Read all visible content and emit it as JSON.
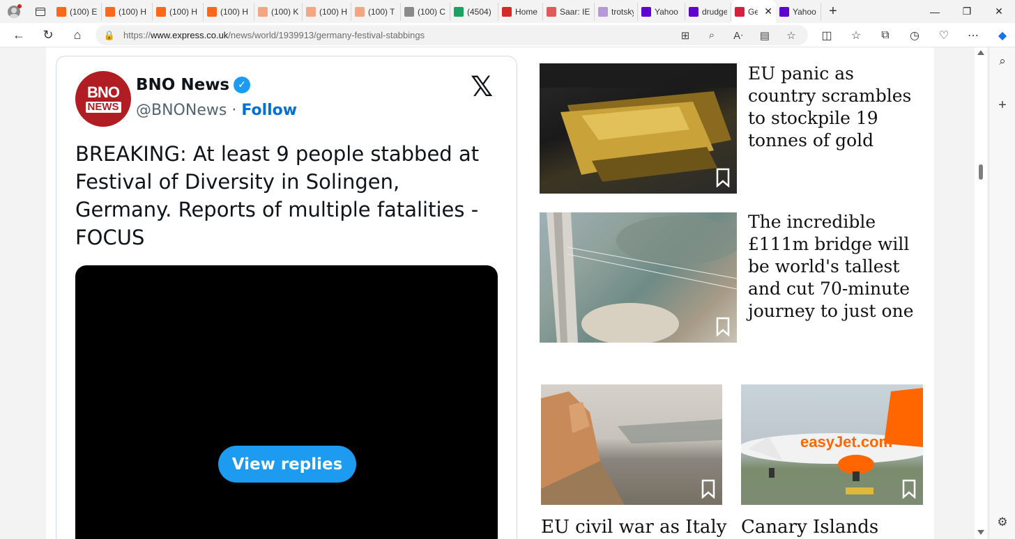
{
  "tabs": [
    {
      "label": "(100) E",
      "favicon": "substack-icon",
      "color": "#ff6719"
    },
    {
      "label": "(100) H",
      "favicon": "substack-icon",
      "color": "#ff6719"
    },
    {
      "label": "(100) H",
      "favicon": "substack-icon",
      "color": "#ff6719"
    },
    {
      "label": "(100) H",
      "favicon": "substack-icon",
      "color": "#ff6719"
    },
    {
      "label": "(100) K",
      "favicon": "substack-icon",
      "color": "#f4a582"
    },
    {
      "label": "(100) H",
      "favicon": "substack-icon",
      "color": "#f4a582"
    },
    {
      "label": "(100) T",
      "favicon": "substack-icon",
      "color": "#f4a582"
    },
    {
      "label": "(100) C",
      "favicon": "grid-icon",
      "color": "#8a8a8a"
    },
    {
      "label": "(4504)",
      "favicon": "g-icon",
      "color": "#1aa260"
    },
    {
      "label": "Home",
      "favicon": "home-icon",
      "color": "#d42a2a"
    },
    {
      "label": "Saar: IE",
      "favicon": "youtube-icon",
      "color": "#e05a5a"
    },
    {
      "label": "trotsky",
      "favicon": "yahoo-icon",
      "color": "#b69ad6"
    },
    {
      "label": "Yahoo",
      "favicon": "yahoo-icon",
      "color": "#5f01d1"
    },
    {
      "label": "drudge",
      "favicon": "yahoo-icon",
      "color": "#5f01d1"
    },
    {
      "label": "Ge",
      "favicon": "express-icon",
      "color": "#d4213d",
      "active": true
    },
    {
      "label": "Yahoo",
      "favicon": "yahoo-icon",
      "color": "#5f01d1"
    }
  ],
  "address": {
    "prefix": "https://",
    "host": "www.express.co.uk",
    "path": "/news/world/1939913/germany-festival-stabbings"
  },
  "tweet": {
    "avatar_top": "BNO",
    "avatar_bottom": "NEWS",
    "name": "BNO News",
    "handle": "@BNONews",
    "separator": "·",
    "follow": "Follow",
    "text": "BREAKING: At least 9 people stabbed at Festival of Diversity in Solingen, Germany. Reports of multiple fatalities - FOCUS",
    "view_replies": "View replies",
    "brand_color": "#1d9bf0"
  },
  "articles": [
    {
      "headline": "EU panic as country scrambles to stockpile 19 tonnes of gold",
      "image": "gold-bars-image"
    },
    {
      "headline": "The incredible £111m bridge will be world's tallest and cut 70-minute journey to just one",
      "image": "bridge-construction-image"
    },
    {
      "headline": "EU civil war as Italy",
      "image": "italy-coast-image"
    },
    {
      "headline": "Canary Islands",
      "image": "easyjet-plane-image"
    }
  ],
  "plane_livery": "easyJet.com"
}
